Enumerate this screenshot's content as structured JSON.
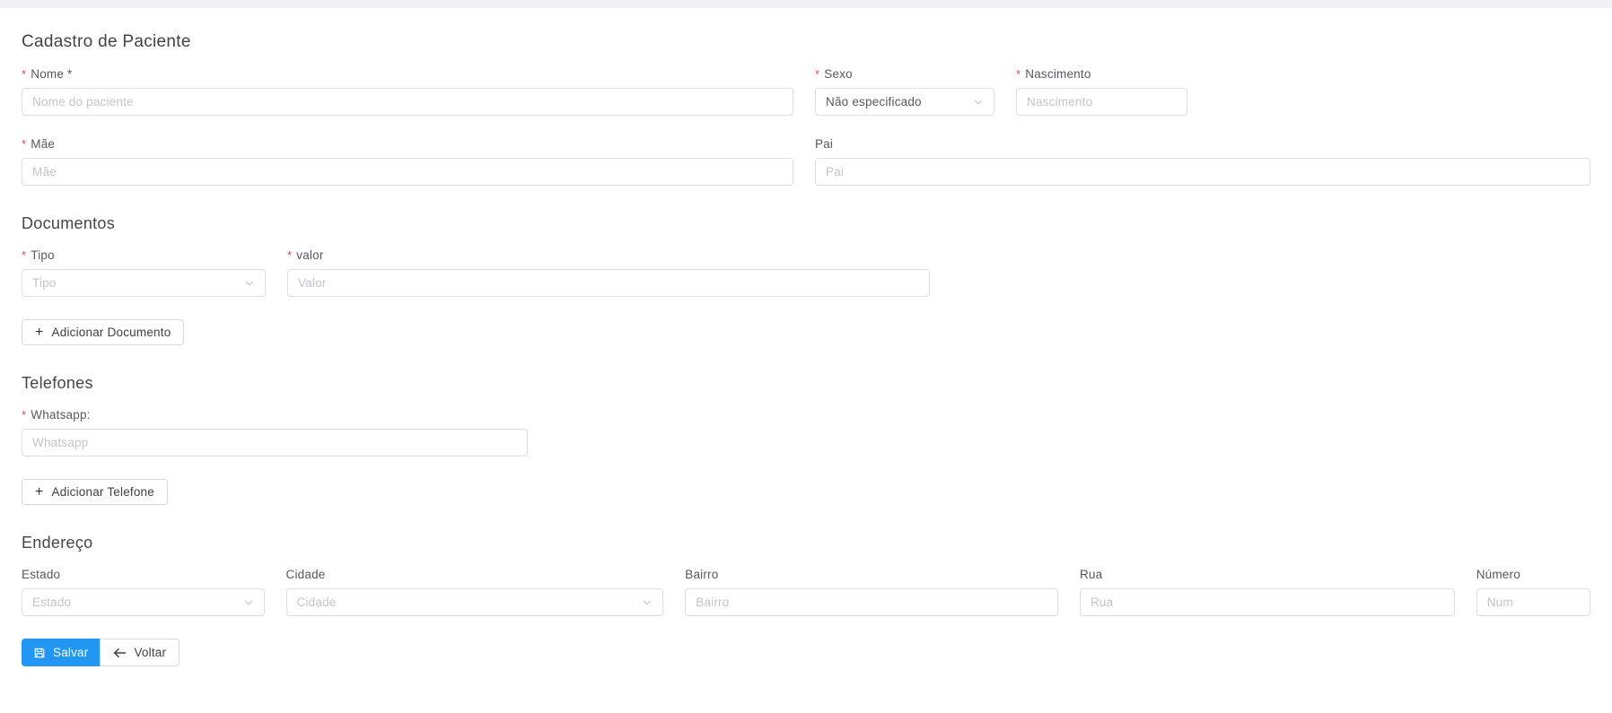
{
  "header": {
    "title": "Cadastro de Paciente"
  },
  "sections": {
    "documentos": "Documentos",
    "telefones": "Telefones",
    "endereco": "Endereço"
  },
  "fields": {
    "nome": {
      "required": "*",
      "label": "Nome *",
      "placeholder": "Nome do paciente"
    },
    "sexo": {
      "required": "*",
      "label": "Sexo",
      "value": "Não especificado"
    },
    "nascimento": {
      "required": "*",
      "label": "Nascimento",
      "placeholder": "Nascimento"
    },
    "mae": {
      "required": "*",
      "label": "Mãe",
      "placeholder": "Mãe"
    },
    "pai": {
      "label": "Pai",
      "placeholder": "Pai"
    },
    "tipo": {
      "required": "*",
      "label": "Tipo",
      "placeholder": "Tipo"
    },
    "valor": {
      "required": "*",
      "label": "valor",
      "placeholder": "Valor"
    },
    "whatsapp": {
      "required": "*",
      "label": "Whatsapp:",
      "placeholder": "Whatsapp"
    },
    "estado": {
      "label": "Estado",
      "placeholder": "Estado"
    },
    "cidade": {
      "label": "Cidade",
      "placeholder": "Cidade"
    },
    "bairro": {
      "label": "Bairro",
      "placeholder": "Bairro"
    },
    "rua": {
      "label": "Rua",
      "placeholder": "Rua"
    },
    "numero": {
      "label": "Número",
      "placeholder": "Num"
    }
  },
  "buttons": {
    "plus": "+",
    "adicionar_documento": "Adicionar Documento",
    "adicionar_telefone": "Adicionar Telefone",
    "salvar": "Salvar",
    "voltar": "Voltar"
  },
  "colors": {
    "accent_blue": "#2196f3",
    "required_red": "#d9534f",
    "topbar_gray": "#eef0f4",
    "border_gray": "#dcdee2",
    "placeholder_gray": "#c0c5cc"
  }
}
